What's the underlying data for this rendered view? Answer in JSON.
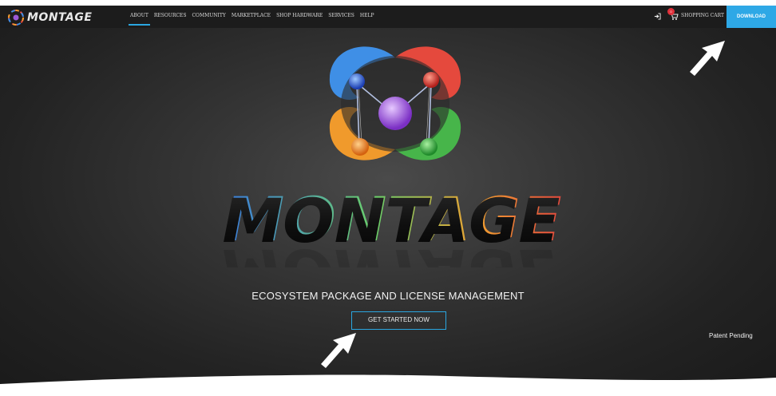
{
  "brand": {
    "name": "MONTAGE",
    "logo_icon": "montage-orb-icon"
  },
  "nav": {
    "items": [
      {
        "label": "ABOUT",
        "active": true
      },
      {
        "label": "RESOURCES"
      },
      {
        "label": "COMMUNITY"
      },
      {
        "label": "MARKETPLACE"
      },
      {
        "label": "SHOP HARDWARE"
      },
      {
        "label": "SERVICES"
      },
      {
        "label": "HELP"
      }
    ],
    "login_icon": "sign-in-icon",
    "cart": {
      "label": "SHOPPING CART",
      "icon": "cart-icon",
      "badge": "0"
    },
    "download_label": "DOWNLOAD"
  },
  "hero": {
    "wordmark": "MONTAGE",
    "tagline": "ECOSYSTEM PACKAGE AND LICENSE MANAGEMENT",
    "cta_label": "GET STARTED NOW",
    "patent": "Patent Pending"
  },
  "colors": {
    "accent": "#2aa6e0",
    "download_bg": "#2ea8e6",
    "nav_bg": "#1c1c1c",
    "hero_bg": "#2e2e2e"
  }
}
